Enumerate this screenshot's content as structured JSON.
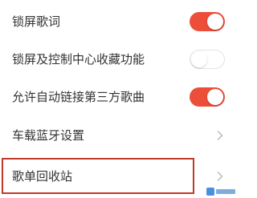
{
  "settings": {
    "items": [
      {
        "label": "锁屏歌词",
        "control": "toggle",
        "enabled": true
      },
      {
        "label": "锁屏及控制中心收藏功能",
        "control": "toggle",
        "enabled": false
      },
      {
        "label": "允许自动链接第三方歌曲",
        "control": "toggle",
        "enabled": true
      },
      {
        "label": "车载蓝牙设置",
        "control": "chevron-right-icon"
      },
      {
        "label": "歌单回收站",
        "control": "chevron-right-icon",
        "highlighted": true
      }
    ]
  },
  "colors": {
    "toggle_on": "#ec4e39",
    "highlight_border": "#c0392b"
  }
}
